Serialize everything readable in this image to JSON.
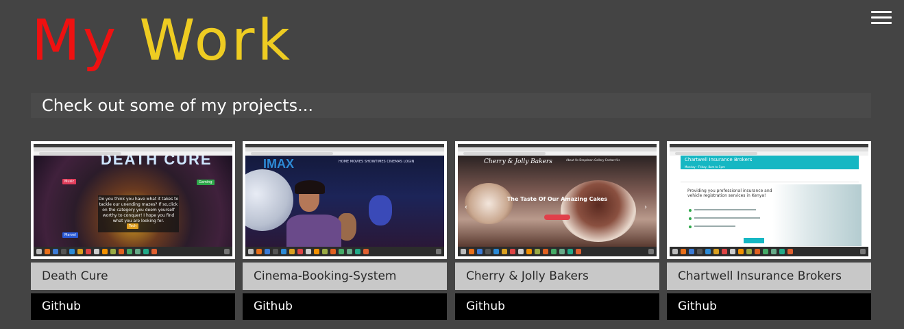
{
  "header": {
    "title_part1": "My",
    "title_part2": "Work",
    "title_color1": "#ee1111",
    "title_color2": "#eecc22",
    "menu_icon": "hamburger-menu-icon"
  },
  "subtitle": "Check out some of my projects...",
  "projects": [
    {
      "name": "Death Cure",
      "link_label": "Github",
      "thumb": {
        "logo": "DEATH CURE",
        "box_text": "Do you think you have what it takes to tackle our unending mazes? If so,click on the category you deem yourself worthy to conquer! I hope you find what you are looking for.",
        "tags": [
          "Music",
          "Gaming",
          "Marvel",
          "Tech"
        ]
      }
    },
    {
      "name": "Cinema-Booking-System",
      "link_label": "Github",
      "thumb": {
        "logo": "IMAX",
        "nav": "HOME   MOVIES   SHOWTIMES   CINEMAS   LOGIN"
      }
    },
    {
      "name": "Cherry & Jolly Bakers",
      "link_label": "Github",
      "thumb": {
        "logo": "Cherry & Jolly Bakers",
        "nav": "About Us   Dropdown   Gallery   Contact Us",
        "headline": "The Taste Of Our Amazing Cakes"
      }
    },
    {
      "name": "Chartwell Insurance Brokers",
      "link_label": "Github",
      "thumb": {
        "band_title": "Chartwell Insurance Brokers",
        "band_sub": "Monday - Friday, 8am to 5pm",
        "text": "Providing you professional insurance and vehicle registration services in Kenya!"
      }
    }
  ]
}
